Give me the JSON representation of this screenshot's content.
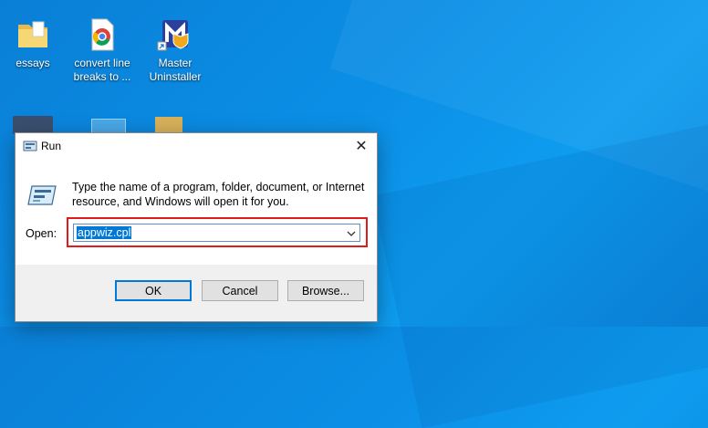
{
  "desktop": {
    "icons": [
      {
        "name": "folder-icon",
        "label_line1": "essays",
        "label_line2": ""
      },
      {
        "name": "chrome-shortcut-icon",
        "label_line1": "convert line",
        "label_line2": "breaks to ..."
      },
      {
        "name": "master-uninstaller-icon",
        "label_line1": "Master",
        "label_line2": "Uninstaller"
      }
    ]
  },
  "run_dialog": {
    "title": "Run",
    "close_glyph": "✕",
    "description": "Type the name of a program, folder, document, or Internet resource, and Windows will open it for you.",
    "open_label": "Open:",
    "open_value": "appwiz.cpl",
    "buttons": {
      "ok": "OK",
      "cancel": "Cancel",
      "browse": "Browse..."
    },
    "highlight_color": "#e01b1b",
    "accent_color": "#0078d7"
  }
}
